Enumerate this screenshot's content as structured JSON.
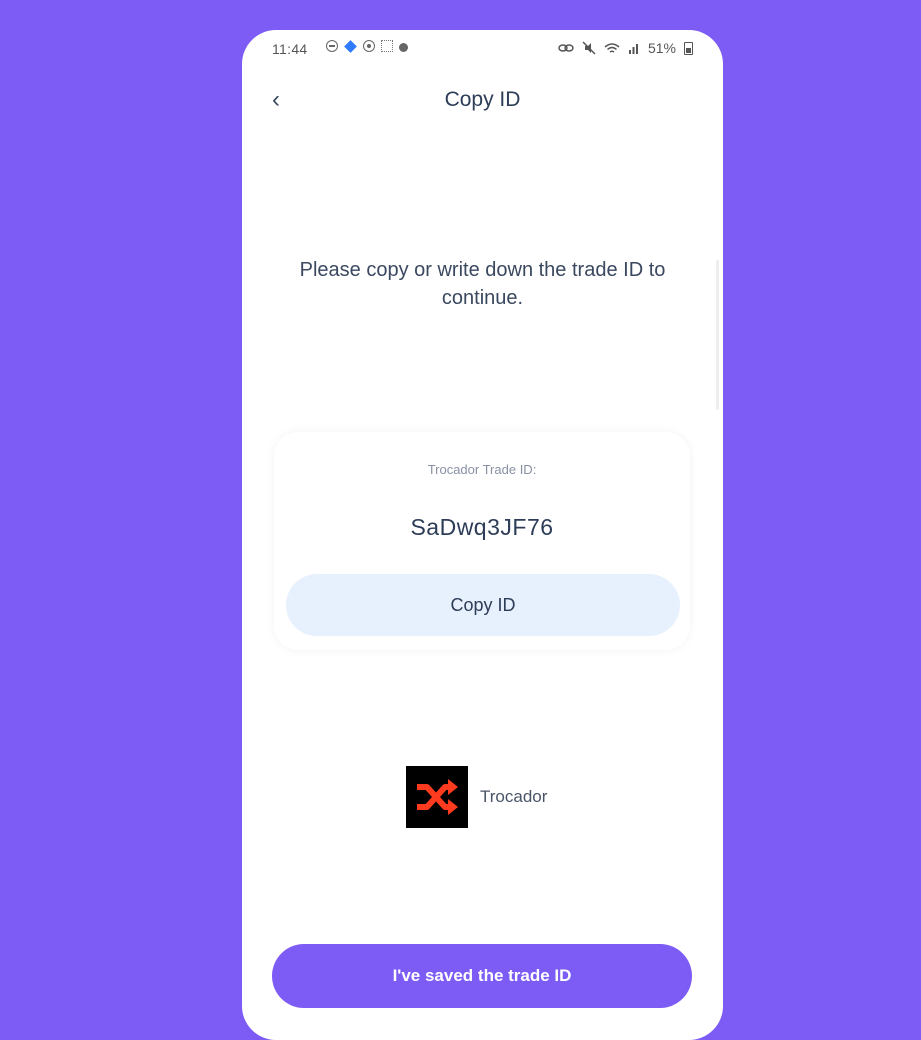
{
  "status_bar": {
    "time": "11:44",
    "battery_text": "51%",
    "icons_left": [
      "do-not-disturb-icon",
      "bluetooth-diamond-icon",
      "record-icon",
      "screenshot-icon",
      "bomb-icon"
    ],
    "icons_right": [
      "link-icon",
      "mute-icon",
      "wifi-icon",
      "signal-icon",
      "battery-icon"
    ]
  },
  "header": {
    "back_label": "‹",
    "title": "Copy ID"
  },
  "instruction": "Please copy or write down the trade ID to continue.",
  "trade_card": {
    "label": "Trocador Trade ID:",
    "trade_id": "SaDwq3JF76",
    "copy_button_label": "Copy ID"
  },
  "provider": {
    "name": "Trocador",
    "logo_icon": "shuffle-icon",
    "logo_color": "#ff3b1f"
  },
  "footer": {
    "save_button_label": "I've saved the trade ID"
  },
  "colors": {
    "background": "#7c5cf5",
    "accent": "#7c5cf5",
    "copy_button_bg": "#e7f0fd",
    "text_primary": "#2d3d58"
  }
}
